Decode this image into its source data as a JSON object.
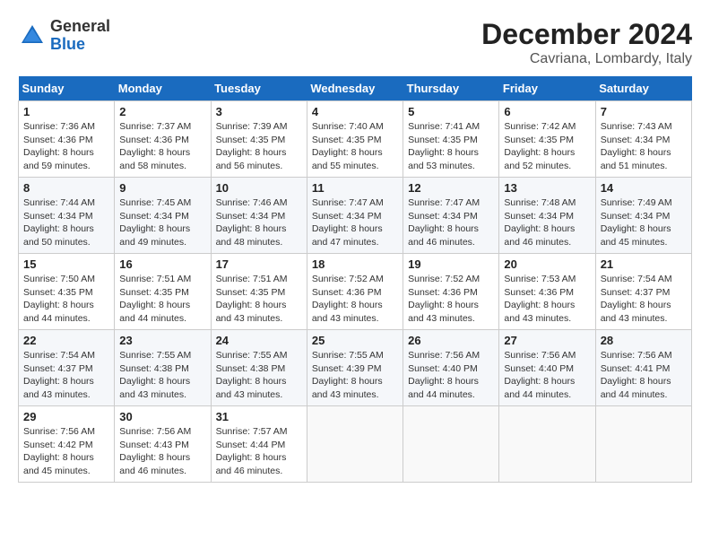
{
  "header": {
    "logo_general": "General",
    "logo_blue": "Blue",
    "title": "December 2024",
    "subtitle": "Cavriana, Lombardy, Italy"
  },
  "calendar": {
    "days_of_week": [
      "Sunday",
      "Monday",
      "Tuesday",
      "Wednesday",
      "Thursday",
      "Friday",
      "Saturday"
    ],
    "weeks": [
      [
        null,
        {
          "day": "2",
          "sunrise": "7:37 AM",
          "sunset": "4:36 PM",
          "daylight": "8 hours and 58 minutes."
        },
        {
          "day": "3",
          "sunrise": "7:39 AM",
          "sunset": "4:35 PM",
          "daylight": "8 hours and 56 minutes."
        },
        {
          "day": "4",
          "sunrise": "7:40 AM",
          "sunset": "4:35 PM",
          "daylight": "8 hours and 55 minutes."
        },
        {
          "day": "5",
          "sunrise": "7:41 AM",
          "sunset": "4:35 PM",
          "daylight": "8 hours and 53 minutes."
        },
        {
          "day": "6",
          "sunrise": "7:42 AM",
          "sunset": "4:35 PM",
          "daylight": "8 hours and 52 minutes."
        },
        {
          "day": "7",
          "sunrise": "7:43 AM",
          "sunset": "4:34 PM",
          "daylight": "8 hours and 51 minutes."
        }
      ],
      [
        {
          "day": "1",
          "sunrise": "7:36 AM",
          "sunset": "4:36 PM",
          "daylight": "8 hours and 59 minutes."
        },
        null,
        null,
        null,
        null,
        null,
        null
      ],
      [
        {
          "day": "8",
          "sunrise": "7:44 AM",
          "sunset": "4:34 PM",
          "daylight": "8 hours and 50 minutes."
        },
        {
          "day": "9",
          "sunrise": "7:45 AM",
          "sunset": "4:34 PM",
          "daylight": "8 hours and 49 minutes."
        },
        {
          "day": "10",
          "sunrise": "7:46 AM",
          "sunset": "4:34 PM",
          "daylight": "8 hours and 48 minutes."
        },
        {
          "day": "11",
          "sunrise": "7:47 AM",
          "sunset": "4:34 PM",
          "daylight": "8 hours and 47 minutes."
        },
        {
          "day": "12",
          "sunrise": "7:47 AM",
          "sunset": "4:34 PM",
          "daylight": "8 hours and 46 minutes."
        },
        {
          "day": "13",
          "sunrise": "7:48 AM",
          "sunset": "4:34 PM",
          "daylight": "8 hours and 46 minutes."
        },
        {
          "day": "14",
          "sunrise": "7:49 AM",
          "sunset": "4:34 PM",
          "daylight": "8 hours and 45 minutes."
        }
      ],
      [
        {
          "day": "15",
          "sunrise": "7:50 AM",
          "sunset": "4:35 PM",
          "daylight": "8 hours and 44 minutes."
        },
        {
          "day": "16",
          "sunrise": "7:51 AM",
          "sunset": "4:35 PM",
          "daylight": "8 hours and 44 minutes."
        },
        {
          "day": "17",
          "sunrise": "7:51 AM",
          "sunset": "4:35 PM",
          "daylight": "8 hours and 43 minutes."
        },
        {
          "day": "18",
          "sunrise": "7:52 AM",
          "sunset": "4:36 PM",
          "daylight": "8 hours and 43 minutes."
        },
        {
          "day": "19",
          "sunrise": "7:52 AM",
          "sunset": "4:36 PM",
          "daylight": "8 hours and 43 minutes."
        },
        {
          "day": "20",
          "sunrise": "7:53 AM",
          "sunset": "4:36 PM",
          "daylight": "8 hours and 43 minutes."
        },
        {
          "day": "21",
          "sunrise": "7:54 AM",
          "sunset": "4:37 PM",
          "daylight": "8 hours and 43 minutes."
        }
      ],
      [
        {
          "day": "22",
          "sunrise": "7:54 AM",
          "sunset": "4:37 PM",
          "daylight": "8 hours and 43 minutes."
        },
        {
          "day": "23",
          "sunrise": "7:55 AM",
          "sunset": "4:38 PM",
          "daylight": "8 hours and 43 minutes."
        },
        {
          "day": "24",
          "sunrise": "7:55 AM",
          "sunset": "4:38 PM",
          "daylight": "8 hours and 43 minutes."
        },
        {
          "day": "25",
          "sunrise": "7:55 AM",
          "sunset": "4:39 PM",
          "daylight": "8 hours and 43 minutes."
        },
        {
          "day": "26",
          "sunrise": "7:56 AM",
          "sunset": "4:40 PM",
          "daylight": "8 hours and 44 minutes."
        },
        {
          "day": "27",
          "sunrise": "7:56 AM",
          "sunset": "4:40 PM",
          "daylight": "8 hours and 44 minutes."
        },
        {
          "day": "28",
          "sunrise": "7:56 AM",
          "sunset": "4:41 PM",
          "daylight": "8 hours and 44 minutes."
        }
      ],
      [
        {
          "day": "29",
          "sunrise": "7:56 AM",
          "sunset": "4:42 PM",
          "daylight": "8 hours and 45 minutes."
        },
        {
          "day": "30",
          "sunrise": "7:56 AM",
          "sunset": "4:43 PM",
          "daylight": "8 hours and 46 minutes."
        },
        {
          "day": "31",
          "sunrise": "7:57 AM",
          "sunset": "4:44 PM",
          "daylight": "8 hours and 46 minutes."
        },
        null,
        null,
        null,
        null
      ]
    ]
  }
}
